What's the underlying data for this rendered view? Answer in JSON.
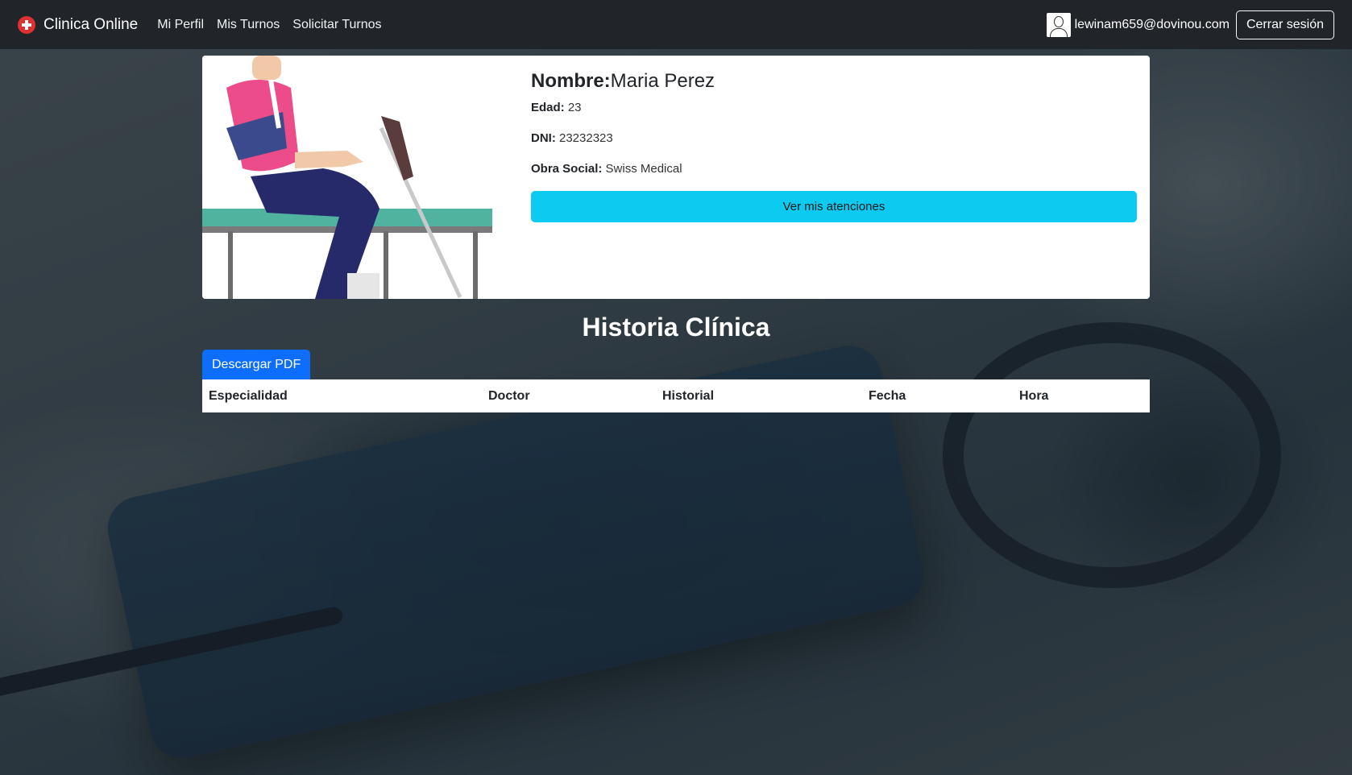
{
  "navbar": {
    "brand": "Clinica Online",
    "links": [
      "Mi Perfil",
      "Mis Turnos",
      "Solicitar Turnos"
    ],
    "user_email": "lewinam659@dovinou.com",
    "logout_label": "Cerrar sesión"
  },
  "profile": {
    "name_label": "Nombre:",
    "name_value": "Maria Perez",
    "age_label": "Edad:",
    "age_value": "23",
    "dni_label": "DNI:",
    "dni_value": "23232323",
    "obra_label": "Obra Social:",
    "obra_value": "Swiss Medical",
    "atenciones_label": "Ver mis atenciones"
  },
  "historia": {
    "title": "Historia Clínica",
    "pdf_label": "Descargar PDF",
    "columns": [
      "Especialidad",
      "Doctor",
      "Historial",
      "Fecha",
      "Hora"
    ],
    "rows": []
  },
  "colors": {
    "navbar_bg": "#212529",
    "info_button": "#0dcaf0",
    "primary_button": "#0d6efd",
    "brand_icon": "#e03131"
  },
  "icons": [
    "clinic-cross-icon",
    "user-avatar-icon"
  ]
}
